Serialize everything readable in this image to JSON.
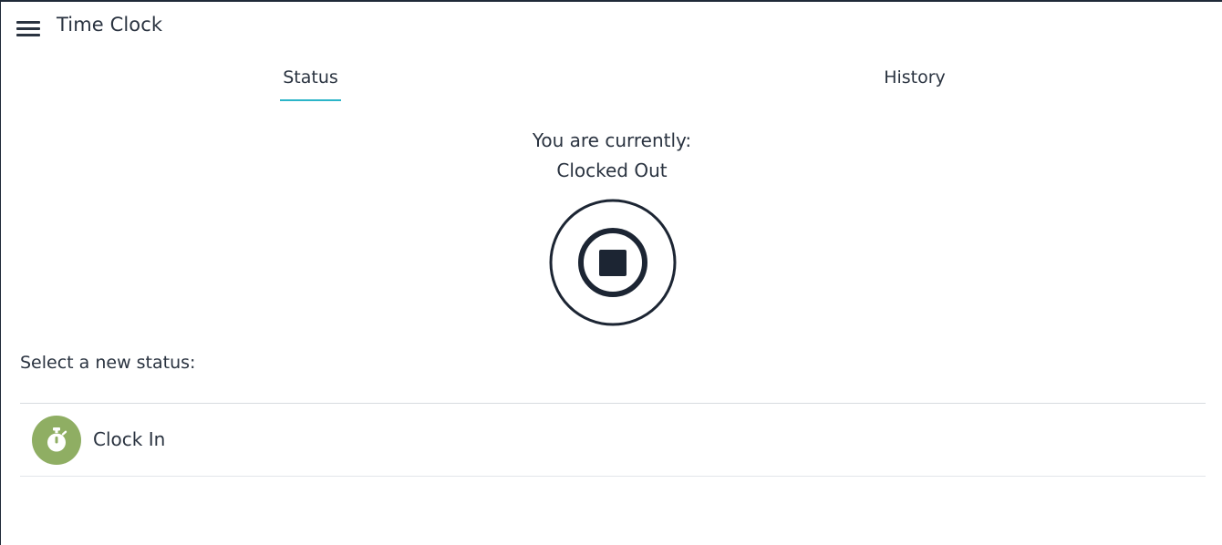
{
  "header": {
    "title": "Time Clock",
    "menu_icon": "hamburger-menu-icon"
  },
  "tabs": [
    {
      "label": "Status",
      "active": true
    },
    {
      "label": "History",
      "active": false
    }
  ],
  "status": {
    "current_label": "You are currently:",
    "current_value": "Clocked Out",
    "badge_icon": "stop-icon"
  },
  "select": {
    "label": "Select a new status:",
    "options": [
      {
        "label": "Clock In",
        "icon": "stopwatch-icon",
        "color": "#8fae63"
      }
    ]
  },
  "colors": {
    "accent": "#2bb5c8",
    "text": "#2a3340",
    "icon_dark": "#1c2533",
    "clock_in": "#8fae63"
  }
}
